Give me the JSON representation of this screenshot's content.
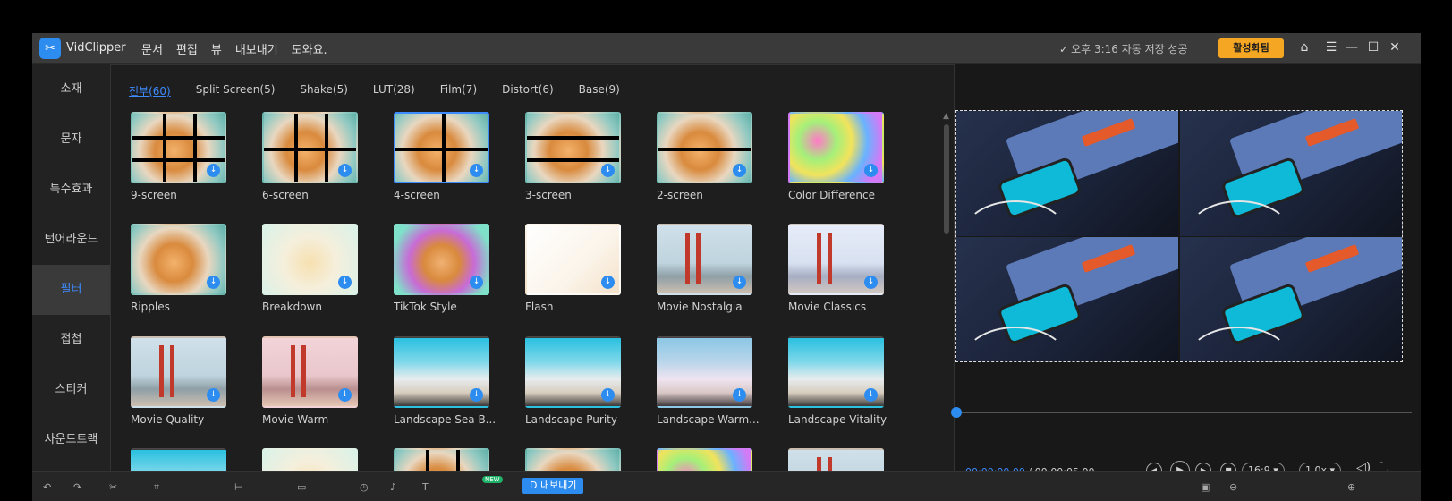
{
  "app": {
    "name": "VidClipper",
    "menu": [
      "문서",
      "편집",
      "뷰",
      "내보내기",
      "도와요."
    ],
    "save_status": "오후 3:16 자동 저장 성공",
    "activate_label": "활성화됨"
  },
  "sidebar": {
    "items": [
      {
        "label": "소재"
      },
      {
        "label": "문자"
      },
      {
        "label": "특수효과"
      },
      {
        "label": "턴어라운드"
      },
      {
        "label": "필터"
      },
      {
        "label": "접첩"
      },
      {
        "label": "스티커"
      },
      {
        "label": "사운드트랙"
      }
    ],
    "active_index": 4
  },
  "filters": {
    "tabs": [
      "전부(60)",
      "Split Screen(5)",
      "Shake(5)",
      "LUT(28)",
      "Film(7)",
      "Distort(6)",
      "Base(9)"
    ],
    "active_tab": 0,
    "items": [
      {
        "label": "9-screen",
        "thumb": "cat-9"
      },
      {
        "label": "6-screen",
        "thumb": "cat-6"
      },
      {
        "label": "4-screen",
        "thumb": "cat-4",
        "selected": true
      },
      {
        "label": "3-screen",
        "thumb": "cat-3"
      },
      {
        "label": "2-screen",
        "thumb": "cat-2"
      },
      {
        "label": "Color Difference",
        "thumb": "cat-color"
      },
      {
        "label": "Ripples",
        "thumb": "cat-ripple"
      },
      {
        "label": "Breakdown",
        "thumb": "cat-break"
      },
      {
        "label": "TikTok Style",
        "thumb": "cat-tiktok"
      },
      {
        "label": "Flash",
        "thumb": "cat-flash"
      },
      {
        "label": "Movie Nostalgia",
        "thumb": "bridge-nostalgia"
      },
      {
        "label": "Movie Classics",
        "thumb": "bridge-classic"
      },
      {
        "label": "Movie Quality",
        "thumb": "bridge-quality"
      },
      {
        "label": "Movie Warm",
        "thumb": "bridge-warm"
      },
      {
        "label": "Landscape Sea B...",
        "thumb": "beach-sea"
      },
      {
        "label": "Landscape Purity",
        "thumb": "beach-purity"
      },
      {
        "label": "Landscape Warm...",
        "thumb": "beach-warm"
      },
      {
        "label": "Landscape Vitality",
        "thumb": "beach-vitality"
      },
      {
        "label": "",
        "thumb": "beach-sea"
      },
      {
        "label": "",
        "thumb": "cat-break"
      },
      {
        "label": "",
        "thumb": "cat-9"
      },
      {
        "label": "",
        "thumb": "cat-2"
      },
      {
        "label": "",
        "thumb": "cat-color"
      },
      {
        "label": "",
        "thumb": "bridge-quality"
      }
    ]
  },
  "preview": {
    "current_time": "00:00:00.00",
    "separator": " / ",
    "total_time": "00:00:05.00",
    "aspect": "16:9",
    "speed": "1.0x",
    "progress": 0.0
  },
  "bottombar": {
    "new_badge": "NEW",
    "export_label": "D 내보내기"
  },
  "colors": {
    "accent": "#2d8cf0",
    "activate": "#f5a623"
  }
}
